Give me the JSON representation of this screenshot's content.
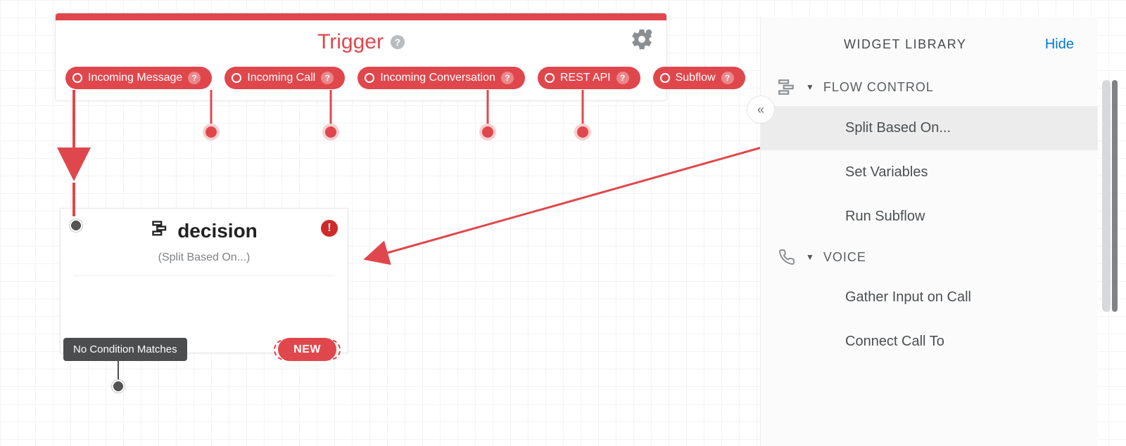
{
  "trigger": {
    "title": "Trigger",
    "pills": [
      {
        "label": "Incoming Message"
      },
      {
        "label": "Incoming Call"
      },
      {
        "label": "Incoming Conversation"
      },
      {
        "label": "REST API"
      },
      {
        "label": "Subflow"
      }
    ]
  },
  "decision": {
    "title": "decision",
    "subtitle": "(Split Based On...)",
    "no_condition": "No Condition Matches",
    "new_label": "NEW"
  },
  "sidebar": {
    "title": "WIDGET LIBRARY",
    "hide": "Hide",
    "categories": [
      {
        "label": "FLOW CONTROL",
        "icon": "flow",
        "items": [
          {
            "label": "Split Based On...",
            "selected": true
          },
          {
            "label": "Set Variables"
          },
          {
            "label": "Run Subflow"
          }
        ]
      },
      {
        "label": "VOICE",
        "icon": "phone",
        "items": [
          {
            "label": "Gather Input on Call"
          },
          {
            "label": "Connect Call To"
          }
        ]
      }
    ]
  }
}
